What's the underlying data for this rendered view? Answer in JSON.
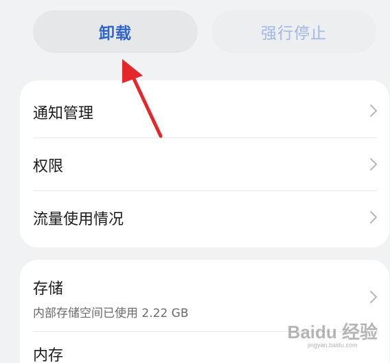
{
  "actions": {
    "uninstall_label": "卸载",
    "force_stop_label": "强行停止"
  },
  "settings_list": {
    "items": [
      {
        "label": "通知管理",
        "icon": "chevron-right-icon"
      },
      {
        "label": "权限",
        "icon": "chevron-right-icon"
      },
      {
        "label": "流量使用情况",
        "icon": "chevron-right-icon"
      }
    ]
  },
  "storage": {
    "label": "存储",
    "description": "内部存储空间已使用 2.22 GB",
    "icon": "chevron-right-icon"
  },
  "memory": {
    "label": "内存"
  },
  "annotation": {
    "arrow_color": "#e5262b",
    "points_to": "uninstall-button"
  },
  "watermark": {
    "main": "Baidu 经验",
    "sub": "jingyan.baidu.com"
  },
  "colors": {
    "accent": "#2f64c8",
    "disabled_accent": "#9fb8e6",
    "background": "#f1f2f4",
    "card": "#ffffff"
  }
}
